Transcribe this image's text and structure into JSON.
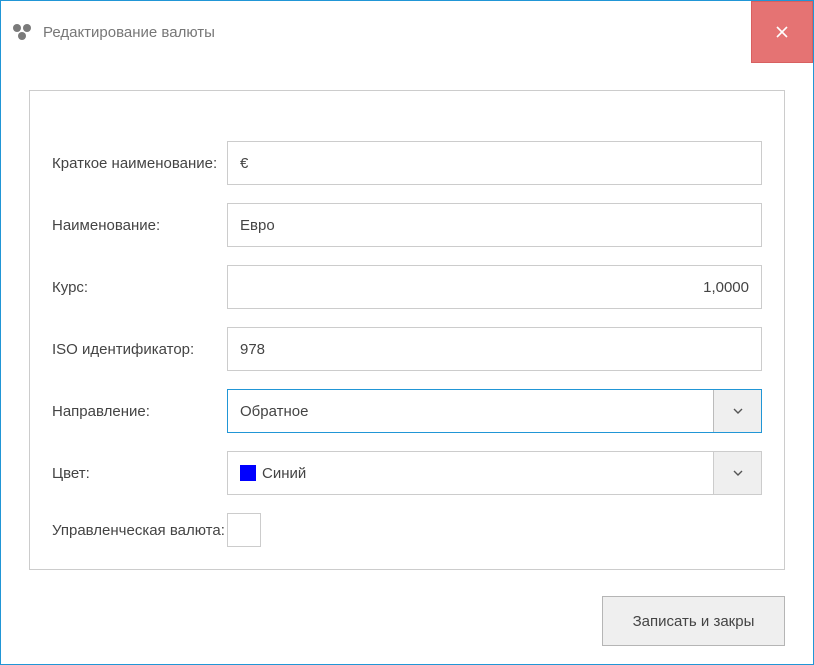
{
  "window": {
    "title": "Редактирование валюты"
  },
  "labels": {
    "short_name": "Краткое наименование:",
    "name": "Наименование:",
    "rate": "Курс:",
    "iso": "ISO идентификатор:",
    "direction": "Направление:",
    "color": "Цвет:",
    "management_currency": "Управленческая валюта:"
  },
  "values": {
    "short_name": "€",
    "name": "Евро",
    "rate": "1,0000",
    "iso": "978",
    "direction": "Обратное",
    "color_name": "Синий",
    "color_hex": "#0000ff",
    "management_checked": false
  },
  "buttons": {
    "save_close": "Записать и закры"
  }
}
